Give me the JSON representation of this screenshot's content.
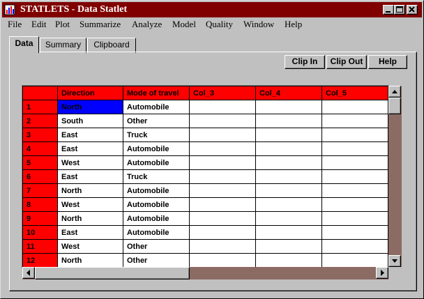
{
  "window": {
    "title": "STATLETS - Data Statlet"
  },
  "menu": [
    "File",
    "Edit",
    "Plot",
    "Summarize",
    "Analyze",
    "Model",
    "Quality",
    "Window",
    "Help"
  ],
  "tabs": [
    "Data",
    "Summary",
    "Clipboard"
  ],
  "active_tab": "Data",
  "toolbar": {
    "clip_in": "Clip In",
    "clip_out": "Clip Out",
    "help": "Help"
  },
  "grid": {
    "columns": [
      "Direction",
      "Mode of travel",
      "Col_3",
      "Col_4",
      "Col_5"
    ],
    "selected_cell": {
      "row": 1,
      "col": 1
    },
    "rows": [
      {
        "n": "1",
        "cells": [
          "North",
          "Automobile",
          "",
          "",
          ""
        ]
      },
      {
        "n": "2",
        "cells": [
          "South",
          "Other",
          "",
          "",
          ""
        ]
      },
      {
        "n": "3",
        "cells": [
          "East",
          "Truck",
          "",
          "",
          ""
        ]
      },
      {
        "n": "4",
        "cells": [
          "East",
          "Automobile",
          "",
          "",
          ""
        ]
      },
      {
        "n": "5",
        "cells": [
          "West",
          "Automobile",
          "",
          "",
          ""
        ]
      },
      {
        "n": "6",
        "cells": [
          "East",
          "Truck",
          "",
          "",
          ""
        ]
      },
      {
        "n": "7",
        "cells": [
          "North",
          "Automobile",
          "",
          "",
          ""
        ]
      },
      {
        "n": "8",
        "cells": [
          "West",
          "Automobile",
          "",
          "",
          ""
        ]
      },
      {
        "n": "9",
        "cells": [
          "North",
          "Automobile",
          "",
          "",
          ""
        ]
      },
      {
        "n": "10",
        "cells": [
          "East",
          "Automobile",
          "",
          "",
          ""
        ]
      },
      {
        "n": "11",
        "cells": [
          "West",
          "Other",
          "",
          "",
          ""
        ]
      },
      {
        "n": "12",
        "cells": [
          "North",
          "Other",
          "",
          "",
          ""
        ]
      }
    ]
  },
  "colors": {
    "titlebar": "#800000",
    "header": "#ff0000",
    "selection": "#0000ff",
    "scroll_track": "#8b6b64",
    "face": "#c0c0c0"
  }
}
